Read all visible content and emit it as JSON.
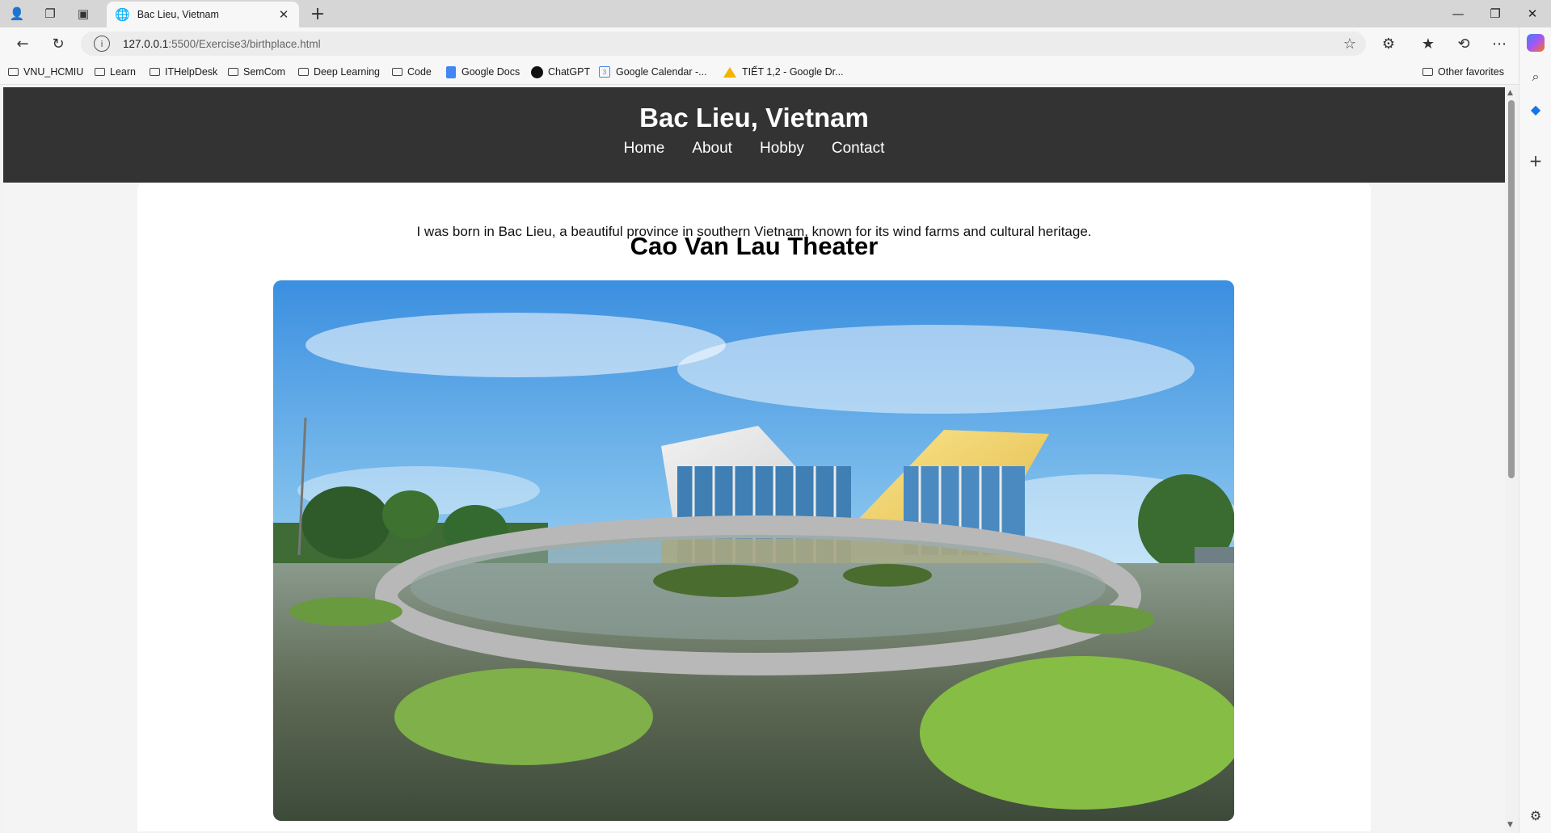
{
  "browser": {
    "tab_title": "Bac Lieu, Vietnam",
    "url_host": "127.0.0.1",
    "url_rest": ":5500/Exercise3/birthplace.html",
    "bookmarks": [
      {
        "label": "VNU_HCMIU",
        "icon": "folder-icon"
      },
      {
        "label": "Learn",
        "icon": "folder-icon"
      },
      {
        "label": "ITHelpDesk",
        "icon": "folder-icon"
      },
      {
        "label": "SemCom",
        "icon": "folder-icon"
      },
      {
        "label": "Deep Learning",
        "icon": "folder-icon"
      },
      {
        "label": "Code",
        "icon": "folder-icon"
      },
      {
        "label": "Google Docs",
        "icon": "google-docs-icon"
      },
      {
        "label": "ChatGPT",
        "icon": "chatgpt-icon"
      },
      {
        "label": "Google Calendar -...",
        "icon": "google-calendar-icon"
      },
      {
        "label": "TIẾT 1,2 - Google Dr...",
        "icon": "google-drive-icon"
      }
    ],
    "other_favorites": "Other favorites"
  },
  "site": {
    "title": "Bac Lieu, Vietnam",
    "nav": [
      "Home",
      "About",
      "Hobby",
      "Contact"
    ],
    "intro": "I was born in Bac Lieu, a beautiful province in southern Vietnam, known for its wind farms and cultural heritage.",
    "section_heading": "Cao Van Lau Theater"
  },
  "colors": {
    "header_bg": "#333333",
    "card_bg": "#ffffff",
    "page_bg": "#f4f4f4"
  }
}
